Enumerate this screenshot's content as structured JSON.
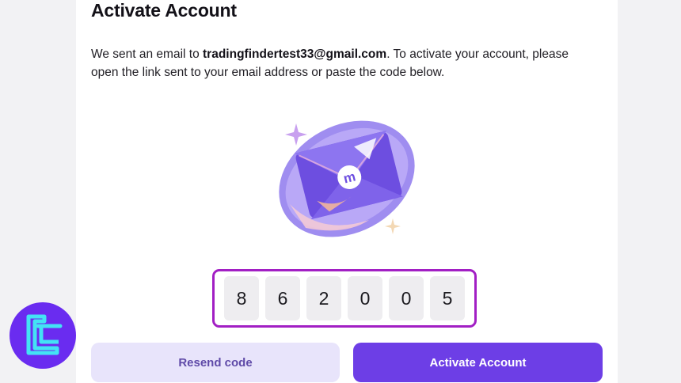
{
  "header": {
    "title": "Activate Account"
  },
  "message": {
    "prefix": "We sent an email to ",
    "email": "tradingfindertest33@gmail.com",
    "suffix": ". To activate your account, please open the link sent to your email address or paste the code below."
  },
  "illustration": {
    "icon": "envelope-illustration",
    "logo_text": "m"
  },
  "code": {
    "digits": [
      "8",
      "6",
      "2",
      "0",
      "0",
      "5"
    ],
    "highlight_color": "#a21fc4"
  },
  "buttons": {
    "resend_label": "Resend code",
    "activate_label": "Activate Account"
  },
  "watermark": {
    "icon": "tradingfinder-logo-badge"
  },
  "colors": {
    "primary": "#6d3ee6",
    "secondary_bg": "#e8e4fb",
    "secondary_text": "#5f4aa8"
  }
}
